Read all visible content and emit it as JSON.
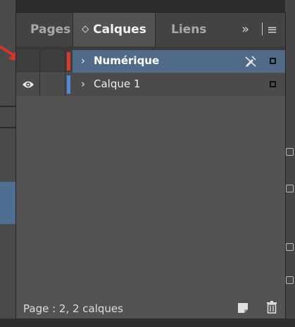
{
  "tabs": {
    "pages": "Pages",
    "calques": "Calques",
    "liens": "Liens",
    "overflow": "»"
  },
  "layers": [
    {
      "name": "Numérique",
      "color": "#d93a2b",
      "visible": false,
      "selected": true,
      "pen_icon": "pen-crossed-icon"
    },
    {
      "name": "Calque 1",
      "color": "#4d8ad8",
      "visible": true,
      "selected": false
    }
  ],
  "footer": {
    "status": "Page : 2, 2 calques"
  },
  "colors": {
    "accent_selected_row": "#4f6b88",
    "panel_bg": "#535353"
  }
}
